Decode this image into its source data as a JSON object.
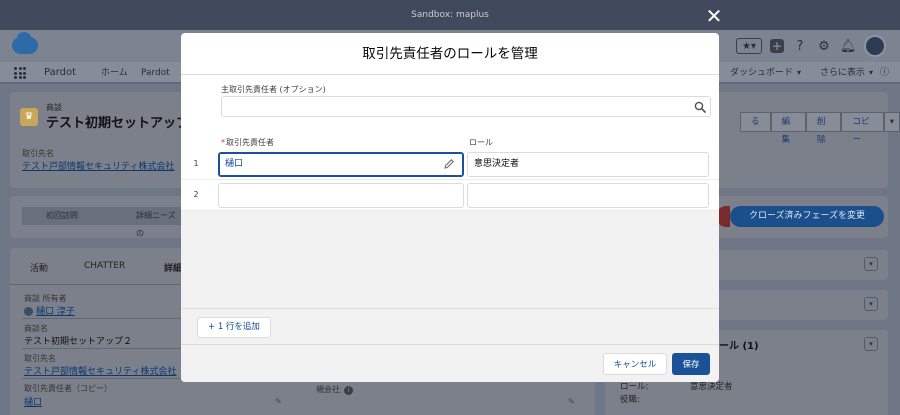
{
  "sandbox_label": "Sandbox: maplus",
  "background": {
    "nav": {
      "app_name": "Pardot",
      "items": [
        "ホーム",
        "Pardot",
        "ダッシュボード",
        "さらに表示"
      ]
    },
    "record": {
      "type_label": "商談",
      "title": "テスト初期セットアップ２",
      "account_label": "取引先名",
      "account_value": "テスト戸部情報セキュリティ株式会社",
      "actions": [
        "る",
        "編集",
        "削除",
        "コピー"
      ]
    },
    "path": {
      "steps": [
        "初回訪問",
        "詳細ニーズの"
      ],
      "close_button": "クローズ済みフェーズを変更"
    },
    "tabs": [
      "活動",
      "CHATTER",
      "詳細"
    ],
    "details": {
      "owner_label": "商談 所有者",
      "owner_value": "樋口 淳子",
      "name_label": "商談名",
      "name_value": "テスト初期セットアップ２",
      "account_label": "取引先名",
      "account_value": "テスト戸部情報セキュリティ株式会社",
      "contact_label": "取引先責任者（コピー）",
      "contact_value": "樋口",
      "parent_label": "親会社"
    },
    "side": {
      "roles_title": "ール (1)",
      "role_key": "ロール:",
      "role_value": "意思決定者",
      "title_key": "役職:"
    }
  },
  "modal": {
    "title": "取引先責任者のロールを管理",
    "primary_contact_label": "主取引先責任者 (オプション)",
    "primary_contact_value": "",
    "columns": {
      "required_mark": "*",
      "contact": "取引先責任者",
      "role": "ロール"
    },
    "rows": [
      {
        "num": "1",
        "contact": "樋口",
        "role": "意思決定者"
      },
      {
        "num": "2",
        "contact": "",
        "role": ""
      }
    ],
    "add_row_label": "+ 1 行を追加",
    "cancel_label": "キャンセル",
    "save_label": "保存"
  },
  "icons": {
    "close": "close-icon",
    "search": "search-icon",
    "pencil": "pencil-icon"
  },
  "colors": {
    "brand_blue": "#1b5297",
    "link_blue": "#0a4a8f",
    "required_red": "#c23934"
  }
}
